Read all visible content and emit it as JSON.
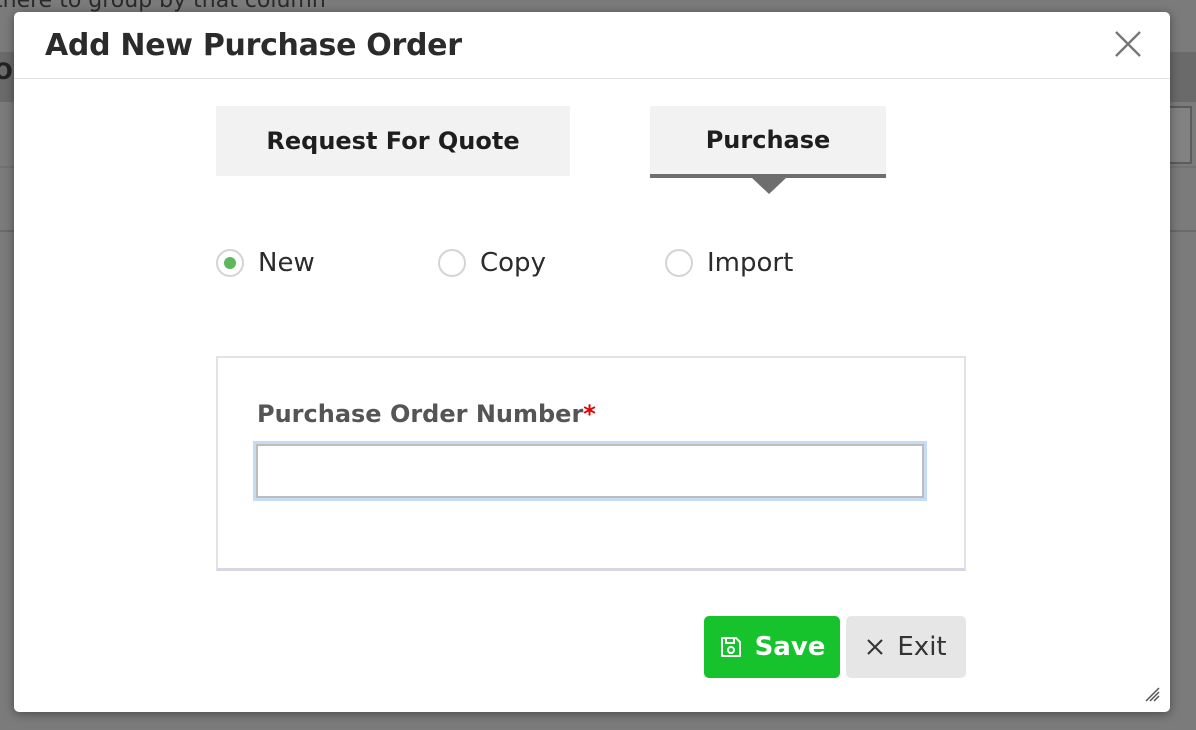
{
  "background": {
    "hint_text": "there to group by that column",
    "partial_header": "Or"
  },
  "dialog": {
    "title": "Add New Purchase Order",
    "close_icon": "close-icon"
  },
  "tabs": [
    {
      "label": "Request For Quote",
      "active": false
    },
    {
      "label": "Purchase",
      "active": true
    }
  ],
  "mode_options": [
    {
      "label": "New",
      "checked": true
    },
    {
      "label": "Copy",
      "checked": false
    },
    {
      "label": "Import",
      "checked": false
    }
  ],
  "form": {
    "po_number_label": "Purchase Order Number",
    "required_marker": "*",
    "po_number_value": "",
    "po_number_placeholder": ""
  },
  "actions": {
    "save_label": "Save",
    "save_icon": "floppy-disk-icon",
    "exit_label": "Exit",
    "exit_icon": "close-icon"
  },
  "colors": {
    "save_button": "#16c32d",
    "exit_button": "#e6e6e6",
    "radio_checked": "#5cb85c",
    "required": "#e00000",
    "input_focus": "#c6dcf6"
  }
}
